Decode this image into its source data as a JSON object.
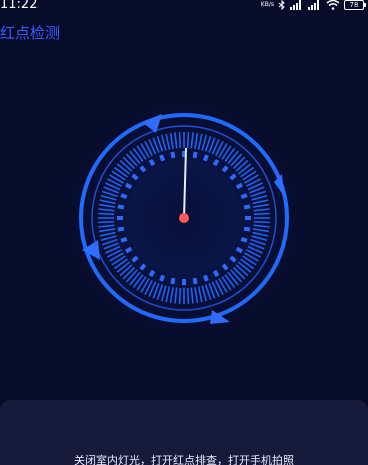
{
  "status_bar": {
    "time": "11:22",
    "net_speed": "KB/s",
    "battery": "78"
  },
  "header": {
    "title": "红点检测"
  },
  "instructions": {
    "text": "关闭室内灯光，打开红点排查，打开手机拍照"
  },
  "colors": {
    "background": "#070b2a",
    "accent_blue": "#1f6bff",
    "title_blue": "#3d5bff",
    "center_dot": "#ff5a5a"
  }
}
